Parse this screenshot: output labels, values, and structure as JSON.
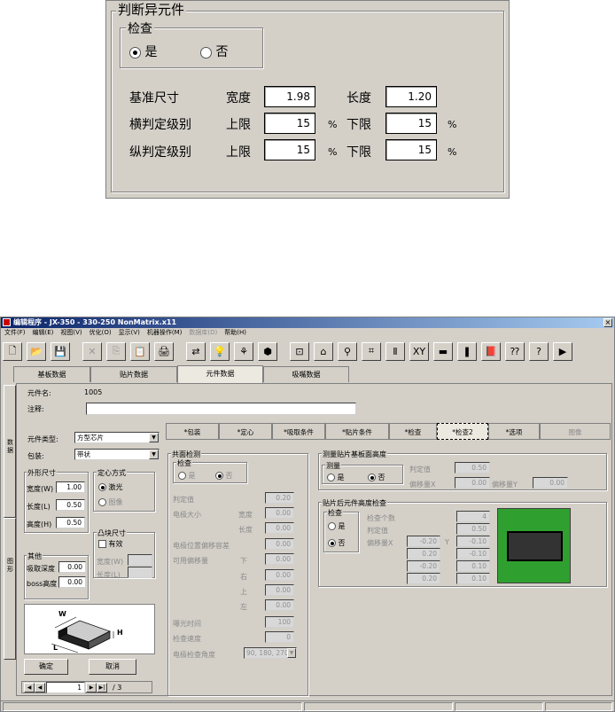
{
  "zoom": {
    "title": "判断异元件",
    "check_group": "检查",
    "opt_yes": "是",
    "opt_no": "否",
    "row1_label": "基准尺寸",
    "width_label": "宽度",
    "width_value": "1.98",
    "length_label": "长度",
    "length_value": "1.20",
    "row2_label": "横判定级别",
    "row3_label": "纵判定级别",
    "upper_label": "上限",
    "lower_label": "下限",
    "pct": "%",
    "h_upper": "15",
    "h_lower": "15",
    "v_upper": "15",
    "v_lower": "15"
  },
  "window": {
    "title": "编辑程序 - JX-350 - 330-250 NonMatrix.x11",
    "close": "×",
    "menu": [
      "文件(F)",
      "编辑(E)",
      "视图(V)",
      "优化(O)",
      "显示(V)",
      "机器操作(M)",
      "数据库(D)",
      "帮助(H)"
    ]
  },
  "toolbar": {
    "icons": [
      "new-icon",
      "open-icon",
      "save-icon",
      "delete-icon",
      "copy-icon",
      "paste-icon",
      "print-icon",
      "switch-icon",
      "light-icon",
      "tree-icon",
      "parts-icon",
      "feeder-icon",
      "hat-icon",
      "nozzle-icon",
      "align-icon",
      "board-icon",
      "xy-icon",
      "camera-icon",
      "run-icon",
      "book-icon",
      "help-pointer-icon",
      "help-icon",
      "export-icon"
    ],
    "glyphs": [
      "🗋",
      "📂",
      "💾",
      "✕",
      "⎘",
      "📋",
      "🖨",
      "⇄",
      "💡",
      "⚘",
      "⬢",
      "⊡",
      "⌂",
      "⚲",
      "⌗",
      "Ⅱ",
      "ΧΥ",
      "▬",
      "❚",
      "📕",
      "⁇",
      "?",
      "▶"
    ]
  },
  "main_tabs": [
    "基板数据",
    "贴片数据",
    "元件数据",
    "吸嘴数据"
  ],
  "side_tabs": [
    "数据",
    "图形"
  ],
  "part": {
    "name_label": "元件名:",
    "name_value": "1005",
    "comment_label": "注释:",
    "type_label": "元件类型:",
    "type_value": "方型芯片",
    "pack_label": "包装:",
    "pack_value": "带状",
    "dim_group": "外形尺寸",
    "dim_w_label": "宽度(W)",
    "dim_w": "1.00",
    "dim_l_label": "长度(L)",
    "dim_l": "0.50",
    "dim_h_label": "高度(H)",
    "dim_h": "0.50",
    "center_group": "定心方式",
    "center_laser": "激光",
    "center_image": "图像",
    "bump_group": "凸块尺寸",
    "bump_check": "有效",
    "bump_w_label": "宽度(W)",
    "bump_l_label": "长度(L)",
    "other_group": "其他",
    "suck_depth_label": "吸取深度",
    "suck_depth": "0.00",
    "boss_label": "boss高度",
    "boss": "0.00",
    "fig_w": "W",
    "fig_h": "H",
    "fig_l": "L",
    "ok": "确定",
    "cancel": "取消",
    "page_value": "1",
    "page_total": "/ 3"
  },
  "inner_tabs": [
    "*包装",
    "*定心",
    "*吸取条件",
    "*贴片条件",
    "*检查",
    "*检查2",
    "*选项",
    "图像"
  ],
  "coplanar": {
    "title": "共面检测",
    "check": "检查",
    "yes": "是",
    "no": "否",
    "tol_label": "判定值",
    "tol": "0.20",
    "lead_size": "电极大小",
    "w_label": "宽度",
    "w": "0.00",
    "l_label": "长度",
    "l": "0.00",
    "lead_pos": "电极位置偏移容差",
    "lead_pos_v": "0.00",
    "offset_label": "可用偏移量",
    "down": "下",
    "down_v": "0.00",
    "right": "右",
    "right_v": "0.00",
    "up": "上",
    "up_v": "0.00",
    "left": "左",
    "left_v": "0.00",
    "delay_label": "曝光时间",
    "delay": "100",
    "speed_label": "检查速度",
    "speed": "0",
    "angle_label": "电极检查角度",
    "angle": "90, 180, 270"
  },
  "measure": {
    "title": "测量贴片基板面高度",
    "measure": "测量",
    "yes": "是",
    "no": "否",
    "judge_label": "判定值",
    "judge": "0.50",
    "offx_label": "偏移量X",
    "offx": "0.00",
    "offy_label": "偏移量Y",
    "offy": "0.00"
  },
  "after": {
    "title": "贴片后元件高度检查",
    "check": "检查",
    "yes": "是",
    "no": "否",
    "count_label": "检查个数",
    "count": "4",
    "judge_label": "判定值",
    "judge": "0.50",
    "offset_label": "偏移量X",
    "y_label": "Y",
    "pts": [
      [
        "-0.20",
        "-0.10"
      ],
      [
        "0.20",
        "-0.10"
      ],
      [
        "-0.20",
        "0.10"
      ],
      [
        "0.20",
        "0.10"
      ]
    ],
    "preview_bg": "#2fa02f"
  }
}
